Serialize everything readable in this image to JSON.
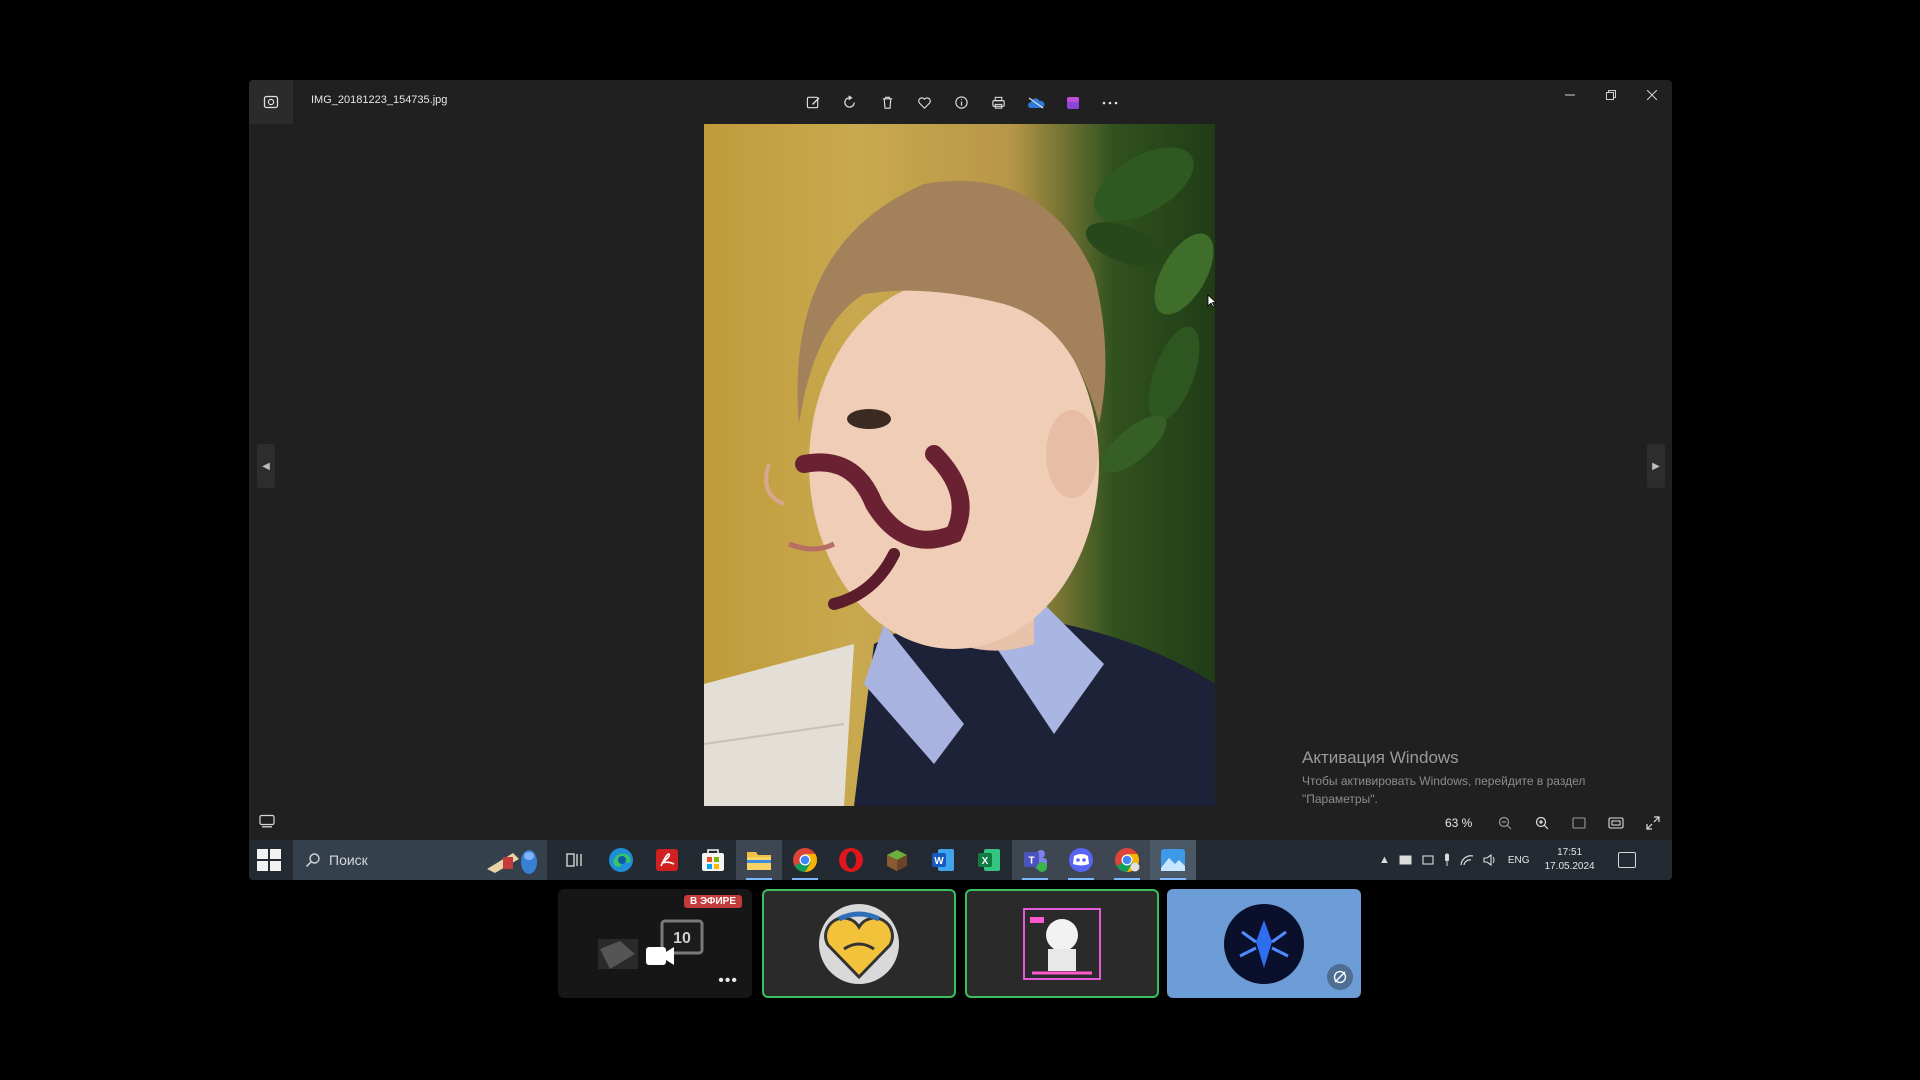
{
  "window": {
    "file_name": "IMG_20181223_154735.jpg",
    "toolbar": [
      "edit-icon",
      "rotate-icon",
      "delete-icon",
      "favorite-icon",
      "info-icon",
      "print-icon",
      "onedrive-icon",
      "clipchamp-icon",
      "more-icon"
    ],
    "controls": [
      "minimize",
      "restore",
      "close"
    ]
  },
  "photo": {
    "subject": "photo"
  },
  "watermark": {
    "title": "Активация Windows",
    "text": "Чтобы активировать Windows, перейдите в раздел \"Параметры\"."
  },
  "viewer_bar": {
    "zoom": "63 %"
  },
  "taskbar": {
    "search_placeholder": "Поиск",
    "apps": [
      "task-view",
      "edge",
      "acrobat",
      "store",
      "file-explorer",
      "chrome",
      "opera",
      "minecraft",
      "word",
      "excel",
      "teams",
      "discord",
      "chrome-profile",
      "photos"
    ],
    "tray": {
      "lang": "ENG",
      "time": "17:51",
      "date": "17.05.2024"
    }
  },
  "participants": [
    {
      "type": "live",
      "badge": "В ЭФИРЕ"
    },
    {
      "type": "avatar"
    },
    {
      "type": "avatar"
    },
    {
      "type": "avatar"
    }
  ],
  "colors": {
    "accent_blue": "#6d9dd6",
    "speaking_green": "#3bbf5a",
    "live_red": "#c33b3b"
  }
}
